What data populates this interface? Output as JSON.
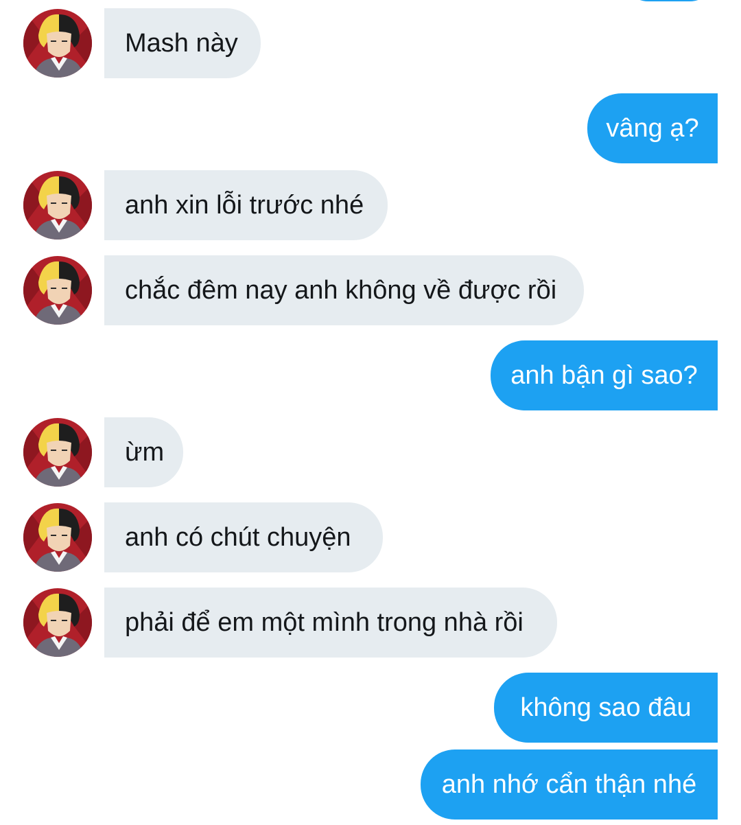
{
  "thread": {
    "messages": [
      {
        "direction": "in",
        "text": "Mash này"
      },
      {
        "direction": "out",
        "text": "vâng ạ?"
      },
      {
        "direction": "in",
        "text": "anh xin lỗi trước nhé"
      },
      {
        "direction": "in",
        "text": "chắc đêm nay anh không về được rồi"
      },
      {
        "direction": "out",
        "text": "anh bận gì sao?"
      },
      {
        "direction": "in",
        "text": "ừm"
      },
      {
        "direction": "in",
        "text": "anh có chút chuyện"
      },
      {
        "direction": "in",
        "text": "phải để em một mình trong nhà rồi"
      },
      {
        "direction": "out",
        "text": "không sao đâu"
      },
      {
        "direction": "out",
        "text": "anh nhớ cẩn thận nhé"
      }
    ]
  },
  "colors": {
    "incoming_bubble": "#e6ecf0",
    "incoming_text": "#14171a",
    "outgoing_bubble": "#1da1f2",
    "outgoing_text": "#ffffff",
    "background": "#ffffff"
  },
  "icons": {
    "avatar": "avatar-icon"
  }
}
